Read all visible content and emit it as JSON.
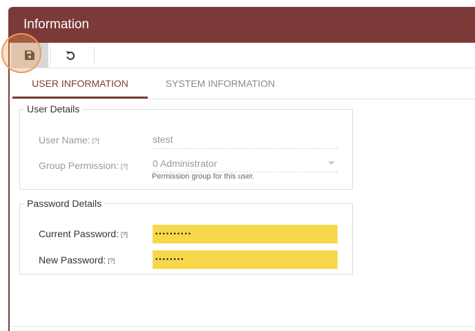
{
  "window": {
    "title": "Information"
  },
  "toolbar": {
    "save_icon": "floppy-disk-icon",
    "undo_icon": "undo-icon"
  },
  "tabs": [
    {
      "label": "USER INFORMATION",
      "active": true
    },
    {
      "label": "SYSTEM INFORMATION",
      "active": false
    }
  ],
  "user_details": {
    "legend": "User Details",
    "username_label": "User Name:",
    "username_value": "stest",
    "group_label": "Group Permission:",
    "group_value": "0 Administrator",
    "group_hint": "Permission group for this user.",
    "help_marker": "[?]"
  },
  "password_details": {
    "legend": "Password Details",
    "current_label": "Current Password:",
    "current_value": "••••••••••",
    "new_label": "New Password:",
    "new_value": "••••••••",
    "help_marker": "[?]"
  },
  "colors": {
    "accent": "#7b3a37",
    "highlight": "#f8d84b",
    "focus_ring": "#ef9a55"
  }
}
